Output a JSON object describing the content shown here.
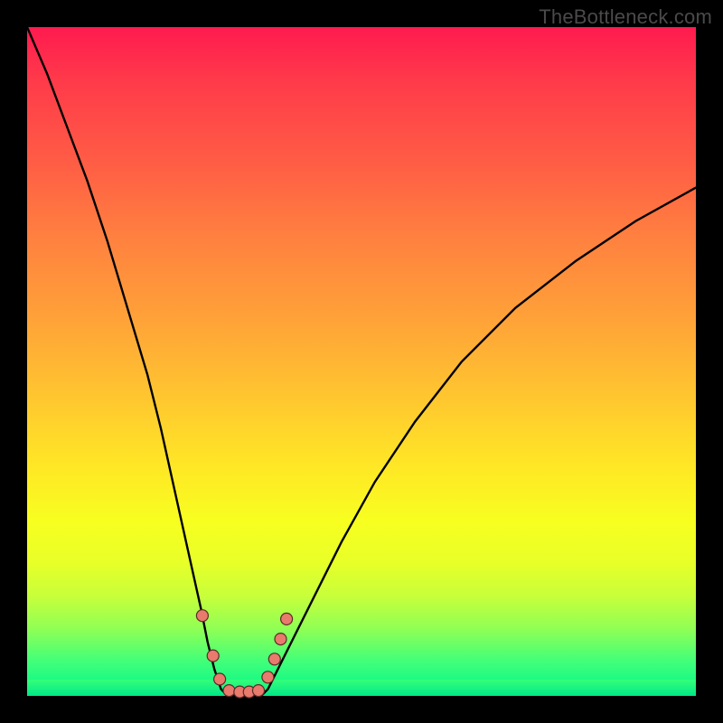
{
  "attribution": "TheBottleneck.com",
  "colors": {
    "frame": "#000000",
    "gradient_top": "#ff1a4f",
    "gradient_mid": "#ffe825",
    "gradient_bottom": "#00e887",
    "curve": "#000000",
    "dot_fill": "#e87a6e",
    "dot_stroke": "#5a2b24"
  },
  "chart_data": {
    "type": "line",
    "title": "",
    "xlabel": "",
    "ylabel": "",
    "xlim": [
      0,
      100
    ],
    "ylim": [
      0,
      100
    ],
    "grid": false,
    "notes": "Two monotone curves descending from opposite upper corners into a shared trough at the bottom-left-of-center. Background vertical gradient encodes value from red (top / high) to green (bottom / low). Pink dots mark sample points near the trough.",
    "series": [
      {
        "name": "left_curve",
        "x": [
          0,
          3,
          6,
          9,
          12,
          15,
          18,
          20,
          22,
          24,
          26,
          27,
          28,
          29,
          30
        ],
        "y": [
          100,
          93,
          85,
          77,
          68,
          58,
          48,
          40,
          31,
          22,
          13,
          8,
          4,
          1,
          0
        ]
      },
      {
        "name": "right_curve",
        "x": [
          35,
          36,
          37,
          38,
          40,
          43,
          47,
          52,
          58,
          65,
          73,
          82,
          91,
          100
        ],
        "y": [
          0,
          1,
          3,
          5,
          9,
          15,
          23,
          32,
          41,
          50,
          58,
          65,
          71,
          76
        ]
      },
      {
        "name": "trough_floor",
        "x": [
          30,
          31,
          32,
          33,
          34,
          35
        ],
        "y": [
          0,
          0,
          0,
          0,
          0,
          0
        ]
      }
    ],
    "dots": [
      {
        "x": 26.2,
        "y": 12.0
      },
      {
        "x": 27.8,
        "y": 6.0
      },
      {
        "x": 28.8,
        "y": 2.5
      },
      {
        "x": 30.2,
        "y": 0.8
      },
      {
        "x": 31.8,
        "y": 0.6
      },
      {
        "x": 33.2,
        "y": 0.6
      },
      {
        "x": 34.6,
        "y": 0.8
      },
      {
        "x": 36.0,
        "y": 2.8
      },
      {
        "x": 37.0,
        "y": 5.5
      },
      {
        "x": 37.9,
        "y": 8.5
      },
      {
        "x": 38.8,
        "y": 11.5
      }
    ]
  }
}
